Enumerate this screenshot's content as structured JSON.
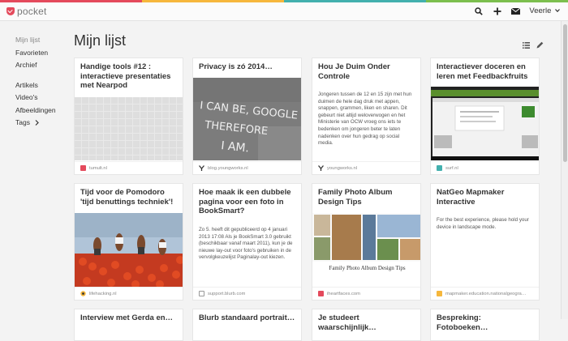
{
  "header": {
    "logo_text": "pocket",
    "user": "Veerle",
    "icons": [
      "search-icon",
      "add-icon",
      "mail-icon",
      "chevron-down-icon"
    ],
    "brand_colors": [
      "#e44a5c",
      "#f6b73c",
      "#43b0ae",
      "#7cbf4e"
    ]
  },
  "sidebar": {
    "items": [
      {
        "label": "Mijn lijst"
      },
      {
        "label": "Favorieten"
      },
      {
        "label": "Archief"
      },
      {
        "label": "Artikels"
      },
      {
        "label": "Video's"
      },
      {
        "label": "Afbeeldingen"
      },
      {
        "label": "Tags"
      }
    ]
  },
  "main": {
    "title": "Mijn lijst",
    "cards": [
      {
        "title": "Handige tools #12 : interactieve presentaties met Nearpod",
        "source": "tumult.nl",
        "favicon_color": "#e44a5c"
      },
      {
        "title": "Privacy is zó 2014…",
        "source": "blog.youngworks.nl",
        "favicon_color": "#333333"
      },
      {
        "title": "Hou Je Duim Onder Controle",
        "excerpt": "Jongeren tussen de 12 en 15 zijn met hun duimen de hele dag druk met appen, snappen, grammen, liken en sharen. Dit gebeurt niet altijd weloverwogen en het Ministerie van OCW vroeg ons iets te bedenken om jongeren beter te laten nadenken over hun gedrag op social media.",
        "source": "youngworks.nl",
        "favicon_color": "#333333"
      },
      {
        "title": "Interactiever doceren en leren met Feedbackfruits",
        "source": "surf.nl",
        "favicon_color": "#43b0ae"
      },
      {
        "title": "Tijd voor de Pomodoro 'tijd benuttings techniek'!",
        "source": "lifehacking.nl",
        "favicon_color": "#f6b73c"
      },
      {
        "title": "Hoe maak ik een dubbele pagina voor een foto in BookSmart?",
        "excerpt": "Zo 5. heeft dit gepubliceerd op 4 januari 2013 17:08 Als je BookSmart 3.0 gebruikt (beschikbaar vanaf maart 2011), kun je de nieuwe lay-out voor foto's gebruiken in de vervolgkeuzelijst Paginalay-out kiezen.",
        "source": "support.blurb.com",
        "favicon_color": "#999999"
      },
      {
        "title": "Family Photo Album Design Tips",
        "image_caption": "Family Photo Album Design Tips",
        "source": "iheartfaces.com",
        "favicon_color": "#e44a5c"
      },
      {
        "title": "NatGeo Mapmaker Interactive",
        "excerpt": "For the best experience, please hold your device in landscape mode.",
        "source": "mapmaker.education.nationalgeogra…",
        "favicon_color": "#f6b73c"
      },
      {
        "title": "Interview met Gerda en…"
      },
      {
        "title": "Blurb standaard portrait…"
      },
      {
        "title": "Je studeert waarschijnlijk…"
      },
      {
        "title": "Bespreking: Fotoboeken…"
      }
    ]
  },
  "image_text": {
    "privacy_photo": [
      "I CAN BE, GOOGLE",
      "THEREFORE",
      "I AM."
    ]
  }
}
